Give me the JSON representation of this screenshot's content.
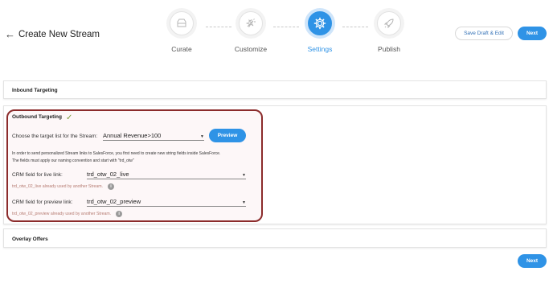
{
  "header": {
    "back_arrow": "←",
    "title": "Create New Stream",
    "save_draft_label": "Save Draft & Edit",
    "next_label": "Next"
  },
  "steps": [
    {
      "label": "Curate",
      "icon": "tray-icon",
      "active": false
    },
    {
      "label": "Customize",
      "icon": "magic-wand-icon",
      "active": false
    },
    {
      "label": "Settings",
      "icon": "gear-icon",
      "active": true
    },
    {
      "label": "Publish",
      "icon": "rocket-icon",
      "active": false
    }
  ],
  "sections": {
    "inbound": {
      "title": "Inbound Targeting"
    },
    "outbound": {
      "title": "Outbound Targeting",
      "check_glyph": "✓",
      "target_list_label": "Choose the target list for the Stream:",
      "target_list_value": "Annual Revenue>100",
      "preview_label": "Preview",
      "info_line1": "In order to send personalized Stream links to SalesForce, you first need to create new string fields inside SalesForce.",
      "info_line2": "The fields must apply our naming convention and start with \"trd_otw\"",
      "live_link_label": "CRM field for live link:",
      "live_link_value": "trd_otw_02_live",
      "live_link_warning": "trd_otw_02_live already used by another Stream.",
      "preview_link_label": "CRM field for preview link:",
      "preview_link_value": "trd_otw_02_preview",
      "preview_link_warning": "trd_otw_02_preview already used by another Stream."
    },
    "overlay": {
      "title": "Overlay Offers"
    }
  },
  "footer": {
    "next_label": "Next"
  },
  "colors": {
    "accent": "#2f93e6",
    "highlight_border": "#8b2b2b",
    "warning_text": "#b57a70"
  }
}
